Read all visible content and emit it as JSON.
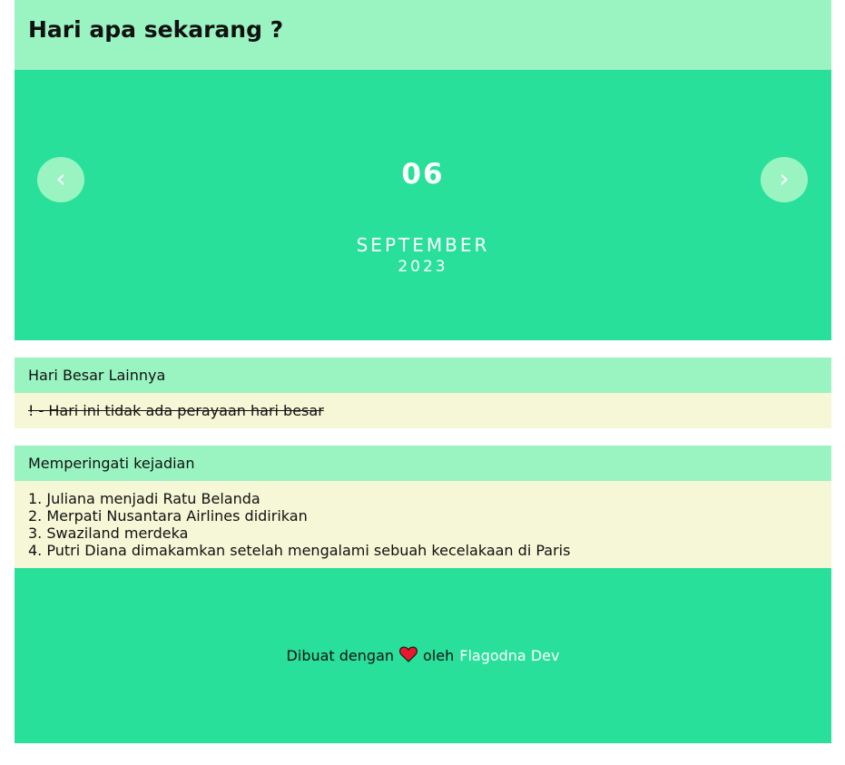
{
  "header": {
    "title": "Hari apa sekarang ?"
  },
  "date": {
    "day": "06",
    "month": "SEPTEMBER",
    "year": "2023",
    "prev_label": "‹",
    "next_label": "›"
  },
  "holidays": {
    "title": "Hari Besar Lainnya",
    "message": "! - Hari ini tidak ada perayaan hari besar"
  },
  "events": {
    "title": "Memperingati kejadian",
    "items": [
      "1. Juliana menjadi Ratu Belanda",
      "2. Merpati Nusantara Airlines didirikan",
      "3. Swaziland merdeka",
      "4. Putri Diana dimakamkan setelah mengalami sebuah kecelakaan di Paris"
    ]
  },
  "footer": {
    "made_with": "Dibuat dengan",
    "by": "oleh",
    "author": "Flagodna Dev",
    "heart_icon": "heart-icon"
  },
  "colors": {
    "header_bg": "#9af4c1",
    "accent": "#28e09a",
    "body_bg": "#f5f7d6",
    "heart": "#e8192c"
  }
}
